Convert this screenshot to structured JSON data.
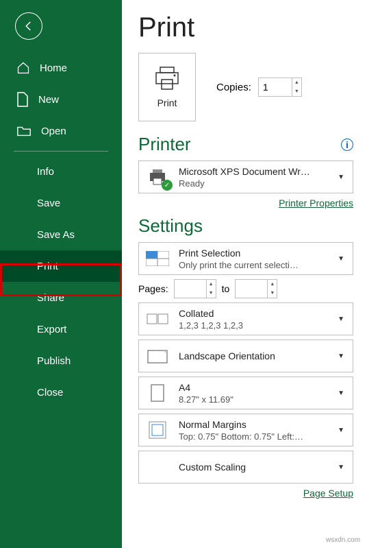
{
  "sidebar": {
    "home": "Home",
    "new": "New",
    "open": "Open",
    "info": "Info",
    "save": "Save",
    "save_as": "Save As",
    "print": "Print",
    "share": "Share",
    "export": "Export",
    "publish": "Publish",
    "close": "Close"
  },
  "title": "Print",
  "print_btn": "Print",
  "copies_label": "Copies:",
  "copies_value": "1",
  "printer_header": "Printer",
  "printer": {
    "name": "Microsoft XPS Document Wr…",
    "status": "Ready"
  },
  "printer_props": "Printer Properties",
  "settings_header": "Settings",
  "setting_selection": {
    "title": "Print Selection",
    "sub": "Only print the current selecti…"
  },
  "pages": {
    "label": "Pages:",
    "from": "",
    "to_label": "to",
    "to": ""
  },
  "setting_collate": {
    "title": "Collated",
    "sub": "1,2,3    1,2,3    1,2,3"
  },
  "setting_orient": {
    "title": "Landscape Orientation"
  },
  "setting_paper": {
    "title": "A4",
    "sub": "8.27\" x 11.69\""
  },
  "setting_margins": {
    "title": "Normal Margins",
    "sub": "Top: 0.75\" Bottom: 0.75\" Left:…"
  },
  "setting_scale": {
    "title": "Custom Scaling"
  },
  "page_setup": "Page Setup",
  "watermark": "wsxdn.com"
}
